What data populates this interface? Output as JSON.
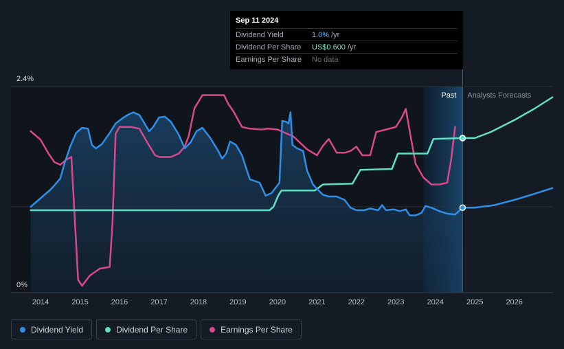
{
  "tooltip": {
    "date": "Sep 11 2024",
    "rows": [
      {
        "label": "Dividend Yield",
        "value": "1.0%",
        "unit": "/yr"
      },
      {
        "label": "Dividend Per Share",
        "value": "US$0.600",
        "unit": "/yr"
      },
      {
        "label": "Earnings Per Share",
        "value": "No data",
        "unit": ""
      }
    ]
  },
  "regions": {
    "past": "Past",
    "forecast": "Analysts Forecasts"
  },
  "legend": [
    {
      "label": "Dividend Yield",
      "color": "#2f8fe6"
    },
    {
      "label": "Dividend Per Share",
      "color": "#5fe0c5"
    },
    {
      "label": "Earnings Per Share",
      "color": "#d9488a"
    }
  ],
  "chart_data": {
    "type": "line",
    "x_ticks": [
      "2014",
      "2015",
      "2016",
      "2017",
      "2018",
      "2019",
      "2020",
      "2021",
      "2022",
      "2023",
      "2024",
      "2025",
      "2026"
    ],
    "y_ticks": [
      "2.4%",
      "0%"
    ],
    "xlim": [
      2013.25,
      2026.98
    ],
    "ylim": [
      0,
      2.4
    ],
    "past_end": 2024.69,
    "highlight_start": 2023.7,
    "series": [
      {
        "name": "Dividend Yield",
        "color": "#2f8fe6",
        "unit": "%",
        "points": [
          [
            2013.75,
            1.0
          ],
          [
            2014.0,
            1.1
          ],
          [
            2014.25,
            1.2
          ],
          [
            2014.35,
            1.25
          ],
          [
            2014.5,
            1.33
          ],
          [
            2014.6,
            1.5
          ],
          [
            2014.75,
            1.7
          ],
          [
            2014.9,
            1.86
          ],
          [
            2015.05,
            1.92
          ],
          [
            2015.2,
            1.91
          ],
          [
            2015.3,
            1.72
          ],
          [
            2015.4,
            1.68
          ],
          [
            2015.55,
            1.73
          ],
          [
            2015.75,
            1.86
          ],
          [
            2015.9,
            1.97
          ],
          [
            2016.1,
            2.04
          ],
          [
            2016.25,
            2.08
          ],
          [
            2016.35,
            2.1
          ],
          [
            2016.5,
            2.07
          ],
          [
            2016.62,
            1.98
          ],
          [
            2016.75,
            1.88
          ],
          [
            2016.85,
            1.93
          ],
          [
            2017.0,
            2.04
          ],
          [
            2017.15,
            2.05
          ],
          [
            2017.3,
            1.99
          ],
          [
            2017.5,
            1.84
          ],
          [
            2017.65,
            1.68
          ],
          [
            2017.8,
            1.75
          ],
          [
            2017.95,
            1.88
          ],
          [
            2018.1,
            1.92
          ],
          [
            2018.3,
            1.8
          ],
          [
            2018.5,
            1.65
          ],
          [
            2018.6,
            1.56
          ],
          [
            2018.7,
            1.62
          ],
          [
            2018.8,
            1.76
          ],
          [
            2018.95,
            1.72
          ],
          [
            2019.1,
            1.6
          ],
          [
            2019.3,
            1.32
          ],
          [
            2019.55,
            1.28
          ],
          [
            2019.7,
            1.13
          ],
          [
            2019.85,
            1.16
          ],
          [
            2020.05,
            1.28
          ],
          [
            2020.12,
            2.0
          ],
          [
            2020.22,
            1.99
          ],
          [
            2020.28,
            1.97
          ],
          [
            2020.33,
            2.1
          ],
          [
            2020.38,
            1.72
          ],
          [
            2020.5,
            1.68
          ],
          [
            2020.65,
            1.65
          ],
          [
            2020.75,
            1.42
          ],
          [
            2020.9,
            1.26
          ],
          [
            2021.0,
            1.21
          ],
          [
            2021.15,
            1.14
          ],
          [
            2021.3,
            1.12
          ],
          [
            2021.5,
            1.12
          ],
          [
            2021.7,
            1.08
          ],
          [
            2021.85,
            0.99
          ],
          [
            2022.0,
            0.96
          ],
          [
            2022.2,
            0.96
          ],
          [
            2022.35,
            0.98
          ],
          [
            2022.55,
            0.96
          ],
          [
            2022.65,
            1.02
          ],
          [
            2022.75,
            0.96
          ],
          [
            2022.95,
            0.97
          ],
          [
            2023.1,
            0.95
          ],
          [
            2023.25,
            0.97
          ],
          [
            2023.35,
            0.9
          ],
          [
            2023.5,
            0.9
          ],
          [
            2023.65,
            0.93
          ],
          [
            2023.75,
            1.01
          ],
          [
            2023.9,
            0.99
          ],
          [
            2024.1,
            0.95
          ],
          [
            2024.3,
            0.92
          ],
          [
            2024.5,
            0.91
          ],
          [
            2024.69,
            0.99
          ],
          [
            2025.0,
            0.99
          ],
          [
            2025.5,
            1.02
          ],
          [
            2026.0,
            1.08
          ],
          [
            2026.5,
            1.15
          ],
          [
            2026.98,
            1.22
          ]
        ]
      },
      {
        "name": "Dividend Per Share",
        "color": "#5fe0c5",
        "unit": "US$",
        "points": [
          [
            2013.75,
            0.96
          ],
          [
            2019.8,
            0.96
          ],
          [
            2019.9,
            1.0
          ],
          [
            2020.02,
            1.13
          ],
          [
            2020.1,
            1.19
          ],
          [
            2020.95,
            1.19
          ],
          [
            2021.15,
            1.26
          ],
          [
            2021.9,
            1.27
          ],
          [
            2022.1,
            1.43
          ],
          [
            2022.9,
            1.44
          ],
          [
            2023.05,
            1.62
          ],
          [
            2023.8,
            1.62
          ],
          [
            2023.95,
            1.79
          ],
          [
            2024.69,
            1.8
          ],
          [
            2025.0,
            1.8
          ],
          [
            2025.4,
            1.87
          ],
          [
            2026.0,
            2.01
          ],
          [
            2026.5,
            2.14
          ],
          [
            2026.98,
            2.28
          ]
        ]
      },
      {
        "name": "Earnings Per Share",
        "color": "#d9488a",
        "unit": "US$",
        "points": [
          [
            2013.75,
            1.88
          ],
          [
            2014.0,
            1.78
          ],
          [
            2014.2,
            1.62
          ],
          [
            2014.35,
            1.52
          ],
          [
            2014.5,
            1.49
          ],
          [
            2014.65,
            1.55
          ],
          [
            2014.78,
            1.58
          ],
          [
            2014.85,
            1.0
          ],
          [
            2014.95,
            0.15
          ],
          [
            2015.05,
            0.08
          ],
          [
            2015.25,
            0.2
          ],
          [
            2015.5,
            0.28
          ],
          [
            2015.75,
            0.3
          ],
          [
            2015.82,
            0.8
          ],
          [
            2015.9,
            1.85
          ],
          [
            2016.0,
            1.93
          ],
          [
            2016.3,
            1.93
          ],
          [
            2016.5,
            1.91
          ],
          [
            2016.7,
            1.75
          ],
          [
            2016.9,
            1.6
          ],
          [
            2017.0,
            1.58
          ],
          [
            2017.3,
            1.58
          ],
          [
            2017.5,
            1.62
          ],
          [
            2017.65,
            1.7
          ],
          [
            2017.75,
            1.82
          ],
          [
            2017.9,
            2.15
          ],
          [
            2018.1,
            2.3
          ],
          [
            2018.3,
            2.3
          ],
          [
            2018.45,
            2.3
          ],
          [
            2018.65,
            2.3
          ],
          [
            2018.75,
            2.2
          ],
          [
            2018.9,
            2.1
          ],
          [
            2019.1,
            1.93
          ],
          [
            2019.3,
            1.91
          ],
          [
            2019.6,
            1.9
          ],
          [
            2019.75,
            1.91
          ],
          [
            2020.0,
            1.9
          ],
          [
            2020.4,
            1.82
          ],
          [
            2020.75,
            1.67
          ],
          [
            2021.0,
            1.6
          ],
          [
            2021.15,
            1.71
          ],
          [
            2021.3,
            1.79
          ],
          [
            2021.5,
            1.63
          ],
          [
            2021.7,
            1.63
          ],
          [
            2021.85,
            1.65
          ],
          [
            2022.0,
            1.7
          ],
          [
            2022.15,
            1.6
          ],
          [
            2022.35,
            1.6
          ],
          [
            2022.5,
            1.87
          ],
          [
            2022.75,
            1.9
          ],
          [
            2023.0,
            1.93
          ],
          [
            2023.15,
            2.04
          ],
          [
            2023.25,
            2.14
          ],
          [
            2023.35,
            1.88
          ],
          [
            2023.5,
            1.5
          ],
          [
            2023.7,
            1.34
          ],
          [
            2023.9,
            1.26
          ],
          [
            2024.1,
            1.26
          ],
          [
            2024.3,
            1.28
          ],
          [
            2024.4,
            1.55
          ],
          [
            2024.5,
            1.93
          ]
        ]
      }
    ]
  }
}
